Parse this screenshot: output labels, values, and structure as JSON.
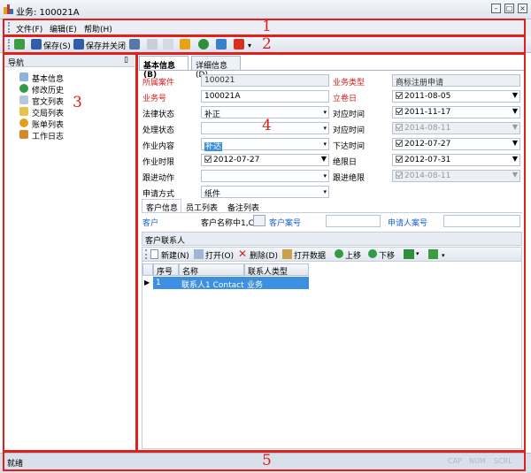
{
  "window": {
    "title": "业务: 100021A"
  },
  "menu": [
    "文件(F)",
    "编辑(E)",
    "帮助(H)"
  ],
  "toolbar": {
    "save": "保存(S)",
    "save_close": "保存并关闭"
  },
  "nav": {
    "header": "导航",
    "pin": "ᵖ",
    "items": [
      "基本信息",
      "修改历史",
      "官文列表",
      "交局列表",
      "账单列表",
      "工作日志"
    ]
  },
  "tabs": [
    "基本信息(B)",
    "详细信息(D)"
  ],
  "form": {
    "suoshu_label": "所属案件",
    "suoshu_value": "100021",
    "yewulx_label": "业务类型",
    "yewulx_value": "商标注册申请",
    "yewuhao_label": "业务号",
    "yewuhao_value": "100021A",
    "lijuan_label": "立卷日",
    "lijuan_value": "2011-08-05",
    "falv_label": "法律状态",
    "falv_value": "补正",
    "duiying1_label": "对应时间",
    "duiying1_value": "2011-11-17",
    "chuli_label": "处理状态",
    "chuli_value": "",
    "duiying2_label": "对应时间",
    "duiying2_value": "2014-08-11",
    "zuoye_label": "作业内容",
    "zuoye_value": "补达",
    "xiada_label": "下达时间",
    "xiada_value": "2012-07-27",
    "shixian_label": "作业时限",
    "shixian_value": "2012-07-27",
    "juexian_label": "绝限日",
    "juexian_value": "2012-07-31",
    "genjin_label": "跟进动作",
    "genjin_value": "",
    "genjinjx_label": "跟进绝限",
    "genjinjx_value": "2014-08-11",
    "shenqing_label": "申请方式",
    "shenqing_value": "纸件"
  },
  "subtabs": [
    "客户信息",
    "员工列表",
    "备注列表"
  ],
  "customer": {
    "kehu_label": "客户",
    "kehu_value": "客户名称中1,C",
    "anhao_label": "客户案号",
    "anhao_value": "",
    "sqrah_label": "申请人案号",
    "sqrah_value": ""
  },
  "contacts": {
    "group_label": "客户联系人",
    "toolbar": [
      "新建(N)",
      "打开(O)",
      "删除(D)",
      "打开数据",
      "上移",
      "下移"
    ],
    "columns": [
      "序号",
      "名称",
      "联系人类型"
    ],
    "rows": [
      {
        "no": "1",
        "name": "联系人1 Contact",
        "type": "业务"
      }
    ]
  },
  "status": {
    "text": "就绪",
    "indicators": [
      "CAP",
      "NUM",
      "SCRL"
    ]
  },
  "callouts": [
    "1",
    "2",
    "3",
    "4",
    "5"
  ]
}
